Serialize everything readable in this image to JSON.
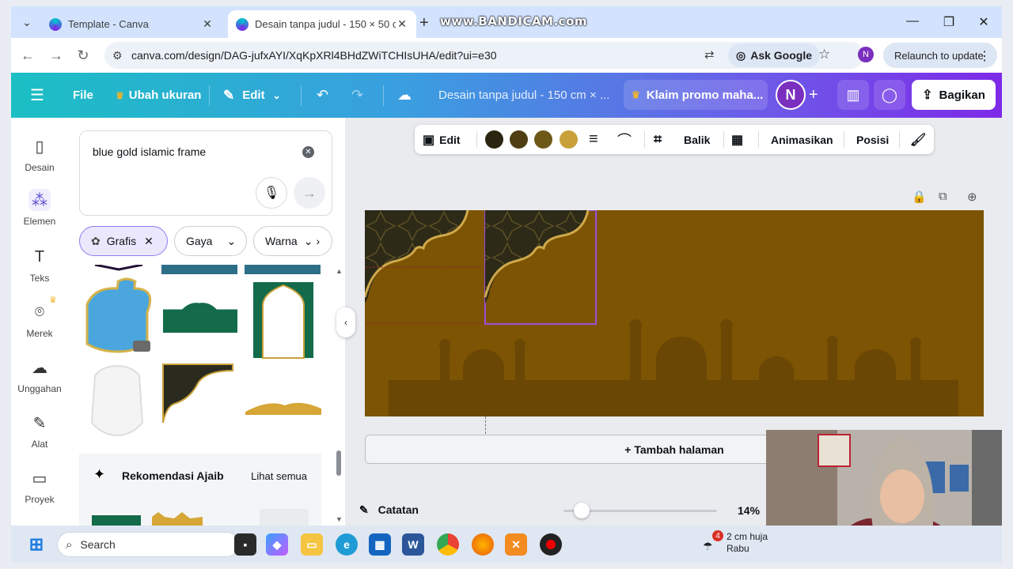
{
  "browser": {
    "tabs": [
      {
        "title": "Template - Canva",
        "active": false
      },
      {
        "title": "Desain tanpa judul - 150 × 50 c",
        "active": true
      }
    ],
    "watermark": "www.BANDICAM.com",
    "url": "canva.com/design/DAG-jufxAYI/XqKpXRl4BHdZWiTCHIsUHA/edit?ui=e30",
    "ask_google": "Ask Google",
    "profile_initial": "N",
    "relaunch": "Relaunch to update"
  },
  "canva": {
    "menu": {
      "file": "File",
      "resize": "Ubah ukuran",
      "edit": "Edit"
    },
    "doc_title": "Desain tanpa judul - 150 cm × ...",
    "promo": "Klaim promo maha...",
    "avatar": "N",
    "share": "Bagikan",
    "rail": [
      {
        "label": "Desain",
        "icon": "layout-icon"
      },
      {
        "label": "Elemen",
        "icon": "shapes-icon"
      },
      {
        "label": "Teks",
        "icon": "text-icon"
      },
      {
        "label": "Merek",
        "icon": "brand-icon"
      },
      {
        "label": "Unggahan",
        "icon": "cloud-upload-icon"
      },
      {
        "label": "Alat",
        "icon": "pen-icon"
      },
      {
        "label": "Proyek",
        "icon": "folder-icon"
      }
    ],
    "search": {
      "query": "blue gold islamic frame"
    },
    "chips": {
      "graphics": "Grafis",
      "style": "Gaya",
      "color": "Warna"
    },
    "recommend": {
      "title": "Rekomendasi Ajaib",
      "see_all": "Lihat semua"
    },
    "context_toolbar": {
      "edit": "Edit",
      "colors": [
        "#2b2410",
        "#4f3e14",
        "#6d5818",
        "#c9a13a"
      ],
      "flip": "Balik",
      "animate": "Animasikan",
      "position": "Posisi"
    },
    "canvas_bg": "#7d5304",
    "add_page": "+ Tambah halaman",
    "notes": "Catatan",
    "zoom": "14%",
    "zoom_fraction": 0.12
  },
  "taskbar": {
    "search": "Search",
    "weather_line1": "2 cm huja",
    "weather_line2": "Rabu",
    "badge": "4"
  }
}
